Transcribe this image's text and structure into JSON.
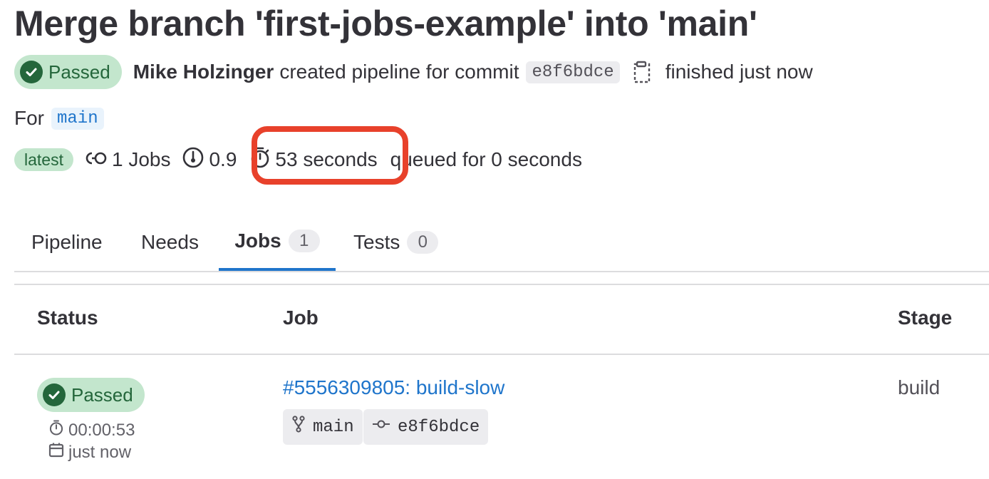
{
  "header": {
    "title": "Merge branch 'first-jobs-example' into 'main'"
  },
  "pipeline": {
    "status": "Passed",
    "author": "Mike Holzinger",
    "created_text": "created pipeline for commit",
    "commit_sha": "e8f6bdce",
    "finished_text": "finished just now",
    "for_label": "For",
    "branch": "main",
    "latest_label": "latest",
    "jobs_count_text": "1 Jobs",
    "compute_text": "0.9",
    "duration_text": "53 seconds",
    "queued_text": "queued for 0 seconds"
  },
  "tabs": [
    {
      "label": "Pipeline"
    },
    {
      "label": "Needs"
    },
    {
      "label": "Jobs",
      "count": "1"
    },
    {
      "label": "Tests",
      "count": "0"
    }
  ],
  "table": {
    "headers": {
      "status": "Status",
      "job": "Job",
      "stage": "Stage"
    },
    "rows": [
      {
        "status": "Passed",
        "duration": "00:00:53",
        "finished": "just now",
        "job": "#5556309805: build-slow",
        "branch": "main",
        "commit": "e8f6bdce",
        "stage": "build"
      }
    ]
  },
  "colors": {
    "success_bg": "#c3e6cd",
    "success_fg": "#24663b",
    "link": "#1f75cb",
    "highlight": "#e8412b"
  }
}
